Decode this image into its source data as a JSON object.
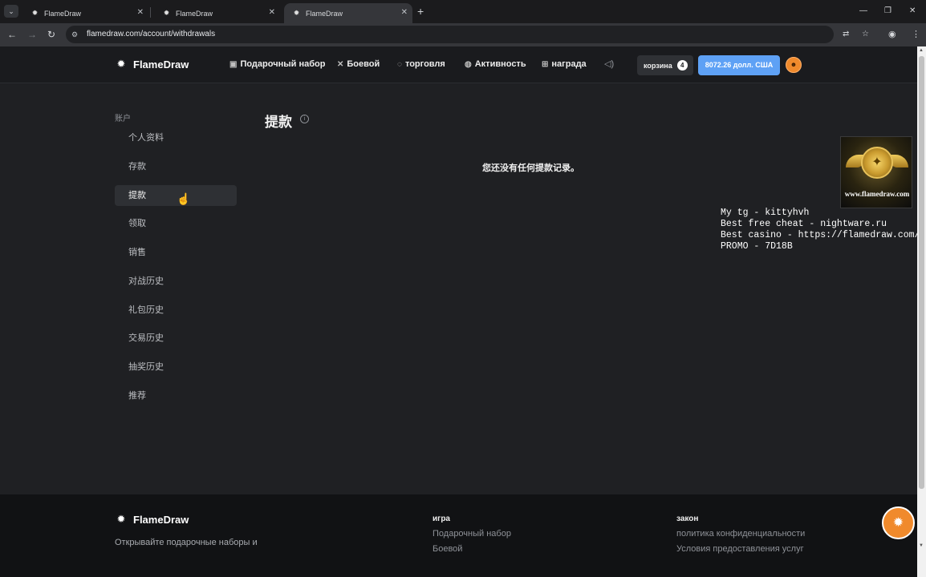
{
  "browser": {
    "tabs": [
      {
        "title": "FlameDraw",
        "active": false
      },
      {
        "title": "FlameDraw",
        "active": false
      },
      {
        "title": "FlameDraw",
        "active": true
      }
    ],
    "url": "flamedraw.com/account/withdrawals"
  },
  "header": {
    "logo": "FlameDraw",
    "nav": [
      {
        "label": "Подарочный набор",
        "icon": "gift-box-icon"
      },
      {
        "label": "Боевой",
        "icon": "swords-icon"
      },
      {
        "label": "торговля",
        "icon": "trade-icon"
      },
      {
        "label": "Активность",
        "icon": "activity-icon"
      },
      {
        "label": "награда",
        "icon": "reward-icon"
      }
    ],
    "cart_label": "корзина",
    "cart_count": "4",
    "balance": "8072.26 долл. США"
  },
  "sidebar": {
    "section_label": "账户",
    "items": [
      {
        "label": "个人资料",
        "active": false
      },
      {
        "label": "存款",
        "active": false
      },
      {
        "label": "提款",
        "active": true
      },
      {
        "label": "领取",
        "active": false
      },
      {
        "label": "销售",
        "active": false
      },
      {
        "label": "对战历史",
        "active": false
      },
      {
        "label": "礼包历史",
        "active": false
      },
      {
        "label": "交易历史",
        "active": false
      },
      {
        "label": "抽奖历史",
        "active": false
      },
      {
        "label": "推荐",
        "active": false
      }
    ]
  },
  "main": {
    "title": "提款",
    "empty_message": "您还没有任何提款记录。"
  },
  "overlay": {
    "badge_text": "www.flamedraw.com",
    "lines": [
      "My tg - kittyhvh",
      "Best free cheat - nightware.ru",
      "Best casino - https://flamedraw.com/",
      "PROMO - 7D18B"
    ]
  },
  "footer": {
    "logo": "FlameDraw",
    "description": "Открывайте подарочные наборы и",
    "col1_title": "игра",
    "col1_links": [
      "Подарочный набор",
      "Боевой"
    ],
    "col2_title": "закон",
    "col2_links": [
      "политика конфиденциальности",
      "Условия предоставления услуг"
    ]
  },
  "colors": {
    "accent_blue": "#5ea1f5",
    "accent_orange": "#f08a2c",
    "page_bg": "#1f2023",
    "header_bg": "#1a1b1e",
    "footer_bg": "#111214"
  }
}
